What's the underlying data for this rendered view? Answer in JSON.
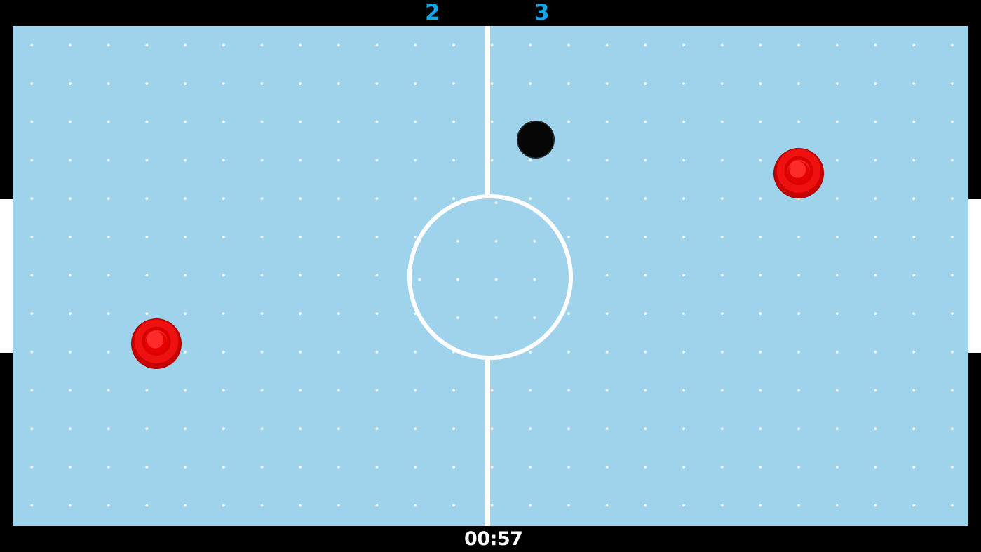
{
  "scoreboard": {
    "left_score": "2",
    "right_score": "3",
    "time_remaining": "00:57"
  },
  "colors": {
    "rink": "#9fd2eb",
    "border": "#000000",
    "score_text": "#12a7e8",
    "timer_text": "#ffffff",
    "mallet": "#e00000",
    "puck": "#050505",
    "lines": "#ffffff"
  }
}
